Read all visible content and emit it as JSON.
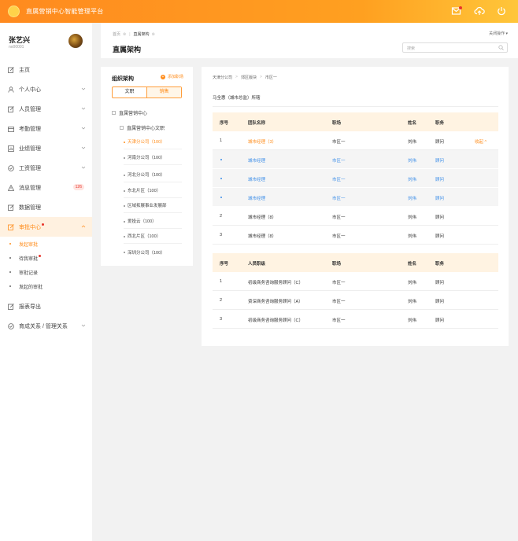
{
  "app": {
    "title": "直属营销中心智能管理平台"
  },
  "topbar": {
    "icons": [
      "mail-icon",
      "cloud-upload-icon",
      "power-icon"
    ],
    "accent": "#ff8c1a"
  },
  "user": {
    "name": "张艺兴",
    "id": "no00001"
  },
  "sidebar": {
    "items": [
      {
        "label": "主页",
        "icon": "edit-icon"
      },
      {
        "label": "个人中心",
        "icon": "user-icon"
      },
      {
        "label": "人员管理",
        "icon": "edit-icon"
      },
      {
        "label": "考勤管理",
        "icon": "calendar-icon"
      },
      {
        "label": "业绩管理",
        "icon": "chart-icon"
      },
      {
        "label": "工资管理",
        "icon": "check-icon"
      },
      {
        "label": "消息管理",
        "icon": "warning-icon",
        "badge": "126"
      },
      {
        "label": "数据管理",
        "icon": "edit-icon"
      },
      {
        "label": "审批中心",
        "icon": "doc-icon"
      }
    ],
    "subitems": [
      "发起审批",
      "待我审批",
      "审批记录",
      "发起的审批"
    ],
    "after": [
      {
        "label": "报表导出",
        "icon": "export-icon"
      },
      {
        "label": "育成关系 / 管理关系",
        "icon": "check-icon"
      }
    ]
  },
  "header": {
    "breadcrumb_home": "首页",
    "breadcrumb_current": "直属架构",
    "title": "直属架构",
    "close_ops": "关闭操作",
    "search_placeholder": "搜索"
  },
  "org": {
    "title": "组织架构",
    "add_label": "添加职场",
    "tabs": [
      "文职",
      "销售"
    ],
    "root": "直属营销中心",
    "child": "直属营销中心文职",
    "leaves": [
      "天津分公司（100）",
      "河南分公司（100）",
      "河北分公司（100）",
      "东北片区（100）",
      "区域拓展事业发展部",
      "爱投云（100）",
      "西北片区（100）",
      "深圳分公司（100）"
    ]
  },
  "main": {
    "path": [
      "天津分公司",
      "郊区版块",
      "市区一"
    ],
    "leader": "马全惠（城市总监）所辖",
    "team_table": {
      "headers": [
        "序号",
        "团队名称",
        "职场",
        "姓名",
        "职务"
      ],
      "rows": [
        {
          "no": "1",
          "name": "城市经理（3）",
          "site": "市区一",
          "person": "刘伟",
          "role": "顾问",
          "action": "收起 ^"
        },
        {
          "no": "",
          "name": "城市经理",
          "site": "市区一",
          "person": "刘伟",
          "role": "顾问"
        },
        {
          "no": "",
          "name": "城市经理",
          "site": "市区一",
          "person": "刘伟",
          "role": "顾问"
        },
        {
          "no": "",
          "name": "城市经理",
          "site": "市区一",
          "person": "刘伟",
          "role": "顾问"
        },
        {
          "no": "2",
          "name": "城市经理（8）",
          "site": "市区一",
          "person": "刘伟",
          "role": "顾问"
        },
        {
          "no": "3",
          "name": "城市经理（8）",
          "site": "市区一",
          "person": "刘伟",
          "role": "顾问"
        }
      ]
    },
    "staff_table": {
      "headers": [
        "序号",
        "人员职级",
        "职场",
        "姓名",
        "职务"
      ],
      "rows": [
        {
          "no": "1",
          "rank": "初级商务咨询服务顾问（C）",
          "site": "市区一",
          "person": "刘伟",
          "role": "顾问"
        },
        {
          "no": "2",
          "rank": "资深商务咨询服务顾问（A）",
          "site": "市区一",
          "person": "刘伟",
          "role": "顾问"
        },
        {
          "no": "3",
          "rank": "初级商务咨询服务顾问（C）",
          "site": "市区一",
          "person": "刘伟",
          "role": "顾问"
        }
      ]
    }
  }
}
